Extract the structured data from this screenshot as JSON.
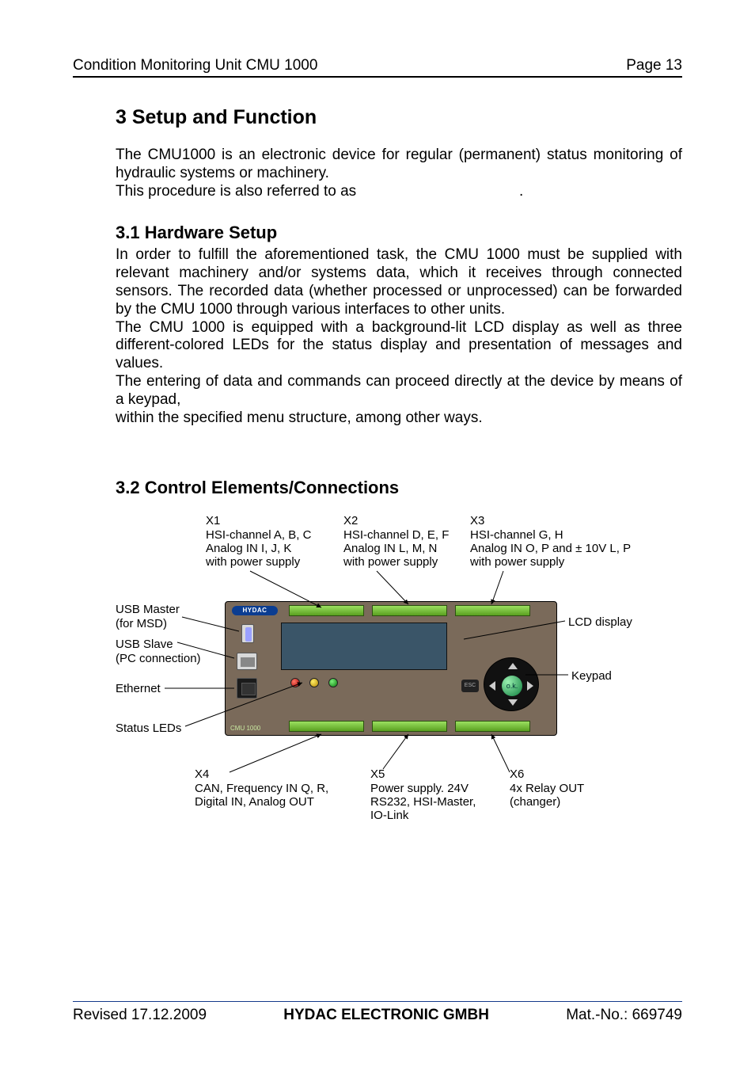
{
  "header": {
    "left": "Condition Monitoring Unit CMU 1000",
    "right": "Page 13"
  },
  "h1": "3  Setup and Function",
  "intro1": "The CMU1000 is an electronic device for regular (permanent) status monitoring of hydraulic systems or machinery.",
  "intro2": "This procedure is also referred to as",
  "intro2_after": ".",
  "h2a": "3.1  Hardware Setup",
  "p1": "In order to fulfill the aforementioned task, the CMU 1000 must be supplied with relevant machinery and/or systems data, which it receives through connected sensors. The recorded data (whether processed or unprocessed) can be forwarded by the CMU 1000 through various interfaces to other units.",
  "p2": "The CMU 1000 is equipped with a background-lit LCD display as well as three different-colored LEDs for the status display and presentation of messages and values.",
  "p3": "The entering of data and commands can proceed directly at the device by means of a keypad,",
  "p4": "within the specified menu structure, among other ways.",
  "h2b": "3.2  Control Elements/Connections",
  "diagram": {
    "brand": "HYDAC",
    "model": "CMU 1000",
    "esc": "ESC",
    "ok": "o.k.",
    "top": {
      "x1": [
        "X1",
        "HSI-channel A, B, C",
        "Analog IN I, J, K",
        "with power supply"
      ],
      "x2": [
        "X2",
        "HSI-channel D, E, F",
        "Analog IN L, M, N",
        "with power supply"
      ],
      "x3": [
        "X3",
        "HSI-channel G, H",
        "Analog IN O, P and ± 10V L, P",
        "with power supply"
      ]
    },
    "left": {
      "usb_master": [
        "USB Master",
        "(for MSD)"
      ],
      "usb_slave": [
        "USB Slave",
        "(PC connection)"
      ],
      "ethernet": "Ethernet",
      "status_leds": "Status LEDs"
    },
    "right": {
      "lcd": "LCD display",
      "keypad": "Keypad"
    },
    "bottom": {
      "x4": [
        "X4",
        "CAN, Frequency IN Q, R,",
        "Digital IN, Analog OUT"
      ],
      "x5": [
        "X5",
        "Power supply. 24V",
        "RS232, HSI-Master,",
        "IO-Link"
      ],
      "x6": [
        "X6",
        "4x Relay OUT",
        "(changer)"
      ]
    }
  },
  "footer": {
    "left": "Revised 17.12.2009",
    "center": "HYDAC ELECTRONIC GMBH",
    "right": "Mat.-No.: 669749"
  }
}
